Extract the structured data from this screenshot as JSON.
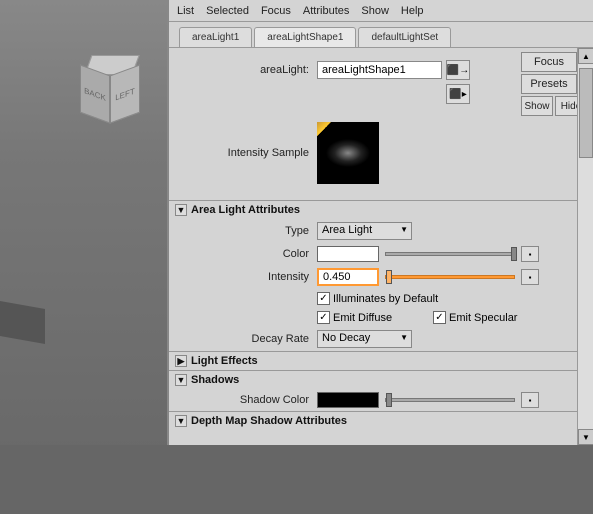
{
  "viewport": {
    "cube_back": "BACK",
    "cube_left": "LEFT"
  },
  "menu": {
    "list": "List",
    "selected": "Selected",
    "focus": "Focus",
    "attributes": "Attributes",
    "show": "Show",
    "help": "Help"
  },
  "tabs": {
    "t1": "areaLight1",
    "t2": "areaLightShape1",
    "t3": "defaultLightSet"
  },
  "side": {
    "focus": "Focus",
    "presets": "Presets",
    "show": "Show",
    "hide": "Hide"
  },
  "header": {
    "label": "areaLight:",
    "value": "areaLightShape1"
  },
  "sample": {
    "label": "Intensity Sample"
  },
  "sections": {
    "ala": "Area Light Attributes",
    "le": "Light Effects",
    "sh": "Shadows",
    "dms": "Depth Map Shadow Attributes"
  },
  "ala": {
    "type_label": "Type",
    "type_value": "Area Light",
    "color_label": "Color",
    "intensity_label": "Intensity",
    "intensity_value": "0.450",
    "illum": "Illuminates by Default",
    "emit_d": "Emit Diffuse",
    "emit_s": "Emit Specular",
    "decay_label": "Decay Rate",
    "decay_value": "No Decay"
  },
  "shadows": {
    "color_label": "Shadow Color"
  }
}
